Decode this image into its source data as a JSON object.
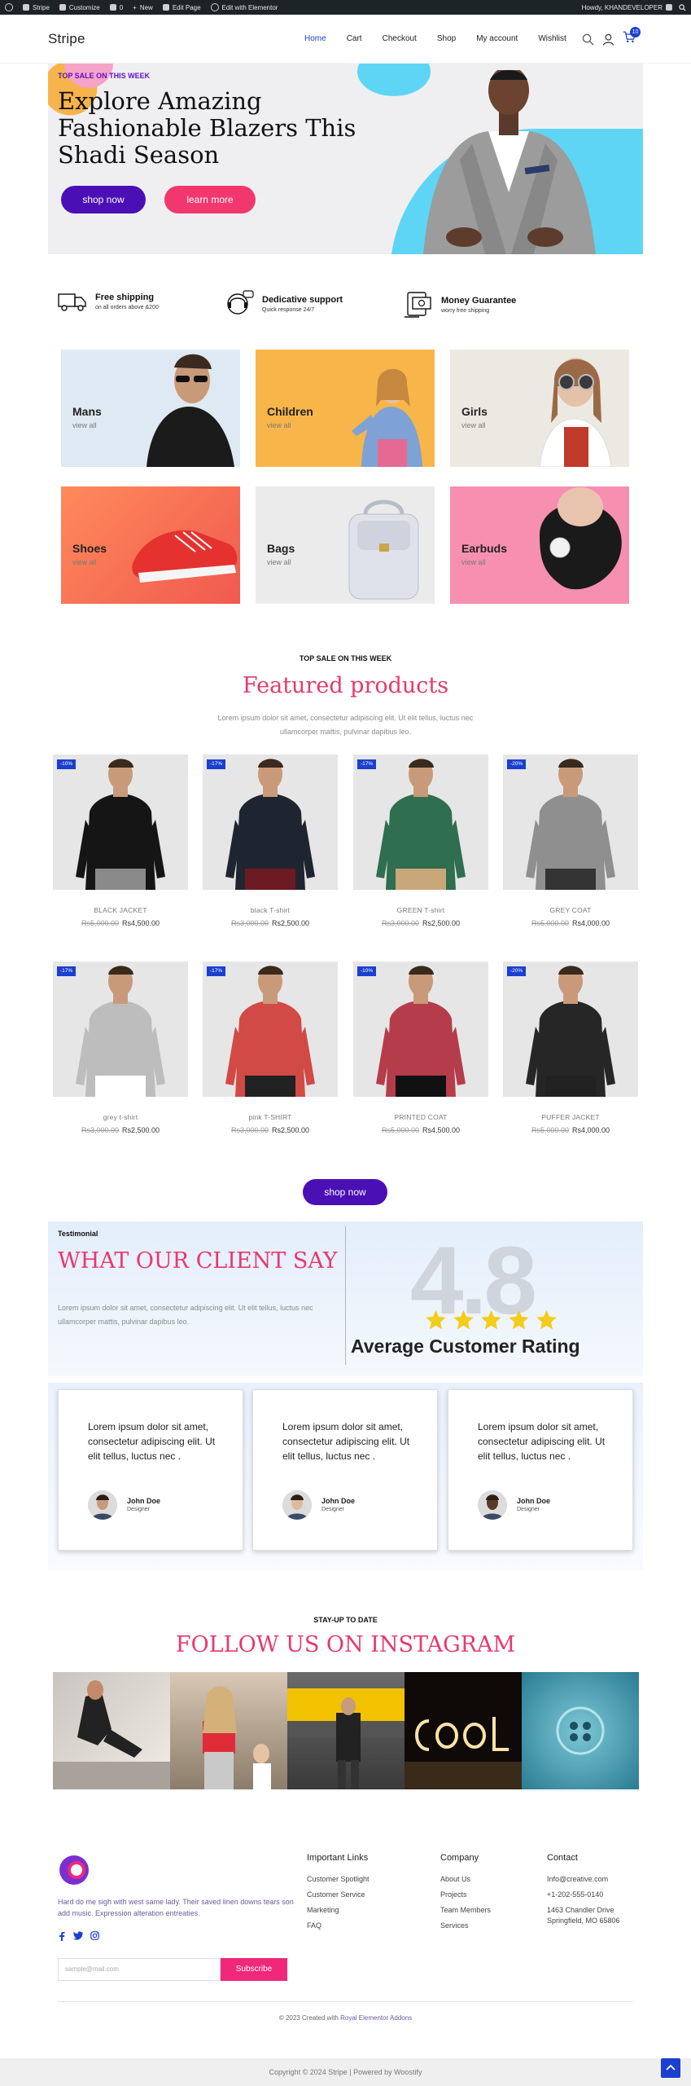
{
  "adminbar": {
    "site": "Stripe",
    "customize": "Customize",
    "comments": "0",
    "new": "New",
    "edit_page": "Edit Page",
    "elementor": "Edit with Elementor",
    "howdy": "Howdy, KHANDEVELOPER"
  },
  "header": {
    "logo": "Stripe",
    "nav": [
      "Home",
      "Cart",
      "Checkout",
      "Shop",
      "My account",
      "Wishlist"
    ],
    "active_nav": "Home",
    "cart_count": "10",
    "colors": {
      "accent": "#1b3fcf"
    }
  },
  "hero": {
    "kicker": "TOP SALE ON THIS WEEK",
    "title": "Explore Amazing Fashionable Blazers This Shadi Season",
    "primary_button": "shop now",
    "secondary_button": "learn more"
  },
  "features": [
    {
      "title": "Free shipping",
      "subtitle": "on all orders above &200",
      "icon": "truck-icon"
    },
    {
      "title": "Dedicative support",
      "subtitle": "Quick response 24/7",
      "icon": "support-icon"
    },
    {
      "title": "Money Guarantee",
      "subtitle": "worry free shipping",
      "icon": "money-icon"
    }
  ],
  "categories": [
    {
      "name": "Mans",
      "sub": "view all"
    },
    {
      "name": "Children",
      "sub": "view all"
    },
    {
      "name": "Girls",
      "sub": "view all"
    },
    {
      "name": "Shoes",
      "sub": "view all"
    },
    {
      "name": "Bags",
      "sub": "view all"
    },
    {
      "name": "Earbuds",
      "sub": "view all"
    }
  ],
  "featured": {
    "kicker": "TOP SALE ON THIS WEEK",
    "title": "Featured products",
    "description": "Lorem ipsum dolor sit amet, consectetur adipiscing elit. Ut elit tellus, luctus nec ullamcorper mattis, pulvinar dapibus leo.",
    "products": [
      {
        "name": "BLACK JACKET",
        "old": "Rs5,000.00",
        "price": "Rs4,500.00",
        "sale": "-10%"
      },
      {
        "name": "black T-shirt",
        "old": "Rs3,000.00",
        "price": "Rs2,500.00",
        "sale": "-17%"
      },
      {
        "name": "GREEN T-shirt",
        "old": "Rs3,000.00",
        "price": "Rs2,500.00",
        "sale": "-17%"
      },
      {
        "name": "GREY COAT",
        "old": "Rs5,000.00",
        "price": "Rs4,000.00",
        "sale": "-20%"
      },
      {
        "name": "grey t-shirt",
        "old": "Rs3,000.00",
        "price": "Rs2,500.00",
        "sale": "-17%"
      },
      {
        "name": "pink T-SHIRT",
        "old": "Rs3,000.00",
        "price": "Rs2,500.00",
        "sale": "-17%"
      },
      {
        "name": "PRINTED COAT",
        "old": "Rs5,000.00",
        "price": "Rs4,500.00",
        "sale": "-10%"
      },
      {
        "name": "PUFFER JACKET",
        "old": "Rs5,000.00",
        "price": "Rs4,000.00",
        "sale": "-20%"
      }
    ],
    "button": "shop now"
  },
  "testimonial": {
    "label": "Testimonial",
    "title": "WHAT OUR CLIENT SAY",
    "description": "Lorem ipsum dolor sit amet, consectetur adipiscing elit. Ut elit tellus, luctus nec ullamcorper mattis, pulvinar dapibus leo.",
    "rating": "4.8",
    "rating_stars": 5,
    "rating_label": "Average Customer Rating",
    "reviews": [
      {
        "text": "Lorem ipsum dolor sit amet, consectetur adipiscing elit. Ut elit tellus, luctus nec .",
        "name": "John Doe",
        "role": "Designer"
      },
      {
        "text": "Lorem ipsum dolor sit amet, consectetur adipiscing elit. Ut elit tellus, luctus nec .",
        "name": "John Doe",
        "role": "Designer"
      },
      {
        "text": "Lorem ipsum dolor sit amet, consectetur adipiscing elit. Ut elit tellus, luctus nec .",
        "name": "John Doe",
        "role": "Designer"
      }
    ]
  },
  "instagram": {
    "kicker": "STAY-UP TO DATE",
    "title": "FOLLOW US ON INSTAGRAM"
  },
  "footer": {
    "description": "Hard do me sigh with west same lady. Their saved linen downs tears son add music. Expression alteration entreaties.",
    "email_placeholder": "sample@mail.com",
    "subscribe": "Subscribe",
    "columns": [
      {
        "heading": "Important Links",
        "links": [
          "Customer Spotlight",
          "Customer Service",
          "Marketing",
          "FAQ"
        ]
      },
      {
        "heading": "Company",
        "links": [
          "About Us",
          "Projects",
          "Team Members",
          "Services"
        ]
      },
      {
        "heading": "Contact",
        "links": [
          "Info@creative.com",
          "+1-202-555-0140",
          "1463 Chandler Drive",
          "Springfield, MO 65806"
        ]
      }
    ],
    "credit_prefix": "© 2023 Created with",
    "credit_link": "Royal Elementor Addons",
    "copyright": "Copyright © 2024 Stripe | Powered by Woostify"
  }
}
